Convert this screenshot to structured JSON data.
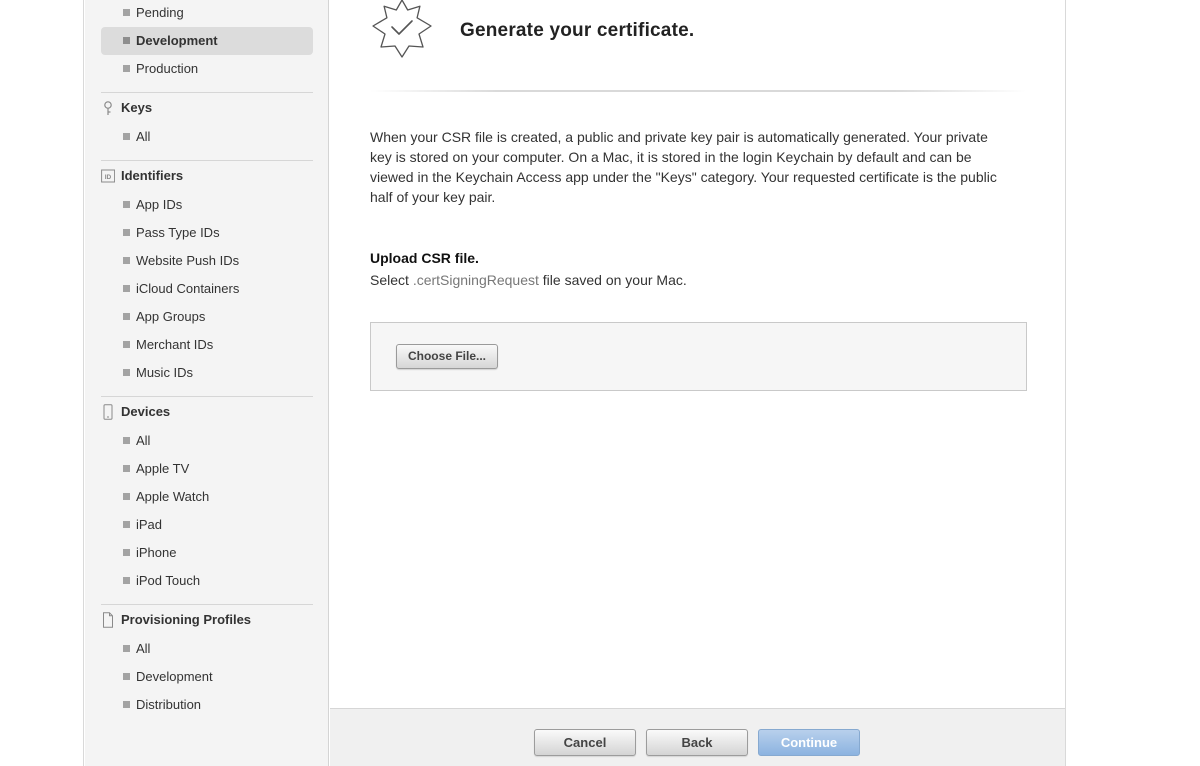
{
  "sidebar": {
    "certificates_items": [
      {
        "label": "Pending",
        "selected": false
      },
      {
        "label": "Development",
        "selected": true
      },
      {
        "label": "Production",
        "selected": false
      }
    ],
    "sections": [
      {
        "title": "Keys",
        "icon": "key-icon",
        "items": [
          "All"
        ]
      },
      {
        "title": "Identifiers",
        "icon": "id-icon",
        "items": [
          "App IDs",
          "Pass Type IDs",
          "Website Push IDs",
          "iCloud Containers",
          "App Groups",
          "Merchant IDs",
          "Music IDs"
        ]
      },
      {
        "title": "Devices",
        "icon": "device-icon",
        "items": [
          "All",
          "Apple TV",
          "Apple Watch",
          "iPad",
          "iPhone",
          "iPod Touch"
        ]
      },
      {
        "title": "Provisioning Profiles",
        "icon": "document-icon",
        "items": [
          "All",
          "Development",
          "Distribution"
        ]
      }
    ]
  },
  "main": {
    "title": "Generate your certificate.",
    "intro": "When your CSR file is created, a public and private key pair is automatically generated. Your private key is stored on your computer. On a Mac, it is stored in the login Keychain by default and can be viewed in the Keychain Access app under the \"Keys\" category. Your requested certificate is the public half of your key pair.",
    "upload_heading": "Upload CSR file.",
    "upload_prefix": "Select",
    "upload_filetype": ".certSigningRequest",
    "upload_suffix": "file saved on your Mac.",
    "choose_file_label": "Choose File..."
  },
  "footer": {
    "cancel_label": "Cancel",
    "back_label": "Back",
    "continue_label": "Continue"
  },
  "colors": {
    "sidebar_bg": "#f4f4f4",
    "selected_bg": "#dcdcdc",
    "continue_button": "#9bbde5",
    "footer_bg": "#f0f0f0"
  }
}
